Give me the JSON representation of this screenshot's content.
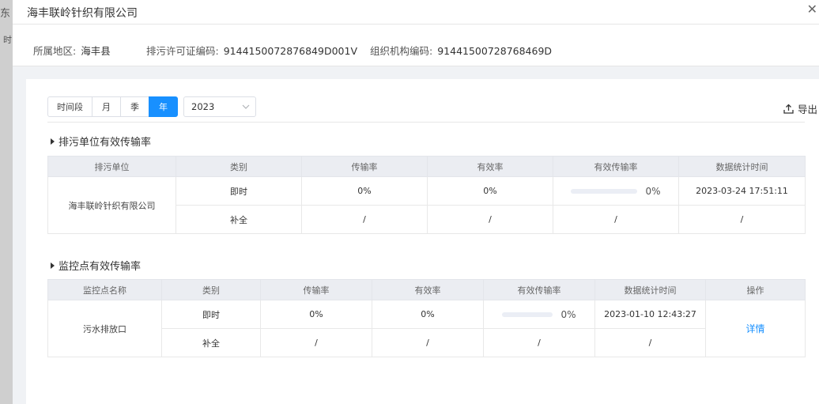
{
  "background": {
    "tab_fragment": "东",
    "sub_fragment": "时"
  },
  "dialog": {
    "title": "海丰联岭针织有限公司",
    "close_glyph": "✕"
  },
  "info": {
    "region_label": "所属地区:",
    "region_value": "海丰县",
    "permit_label": "排污许可证编码:",
    "permit_value": "9144150072876849D001V",
    "org_label": "组织机构编码:",
    "org_value": "91441500728768469D"
  },
  "toolbar": {
    "periods": [
      "时间段",
      "月",
      "季",
      "年"
    ],
    "active_period": "年",
    "year_value": "2023",
    "export_label": "导出"
  },
  "colors": {
    "accent": "#1890ff",
    "header_bg": "#ebedf2"
  },
  "unit_section": {
    "title": "排污单位有效传输率",
    "headers": [
      "排污单位",
      "类别",
      "传输率",
      "有效率",
      "有效传输率",
      "数据统计时间"
    ],
    "unit_name": "海丰联岭针织有限公司",
    "rows": [
      {
        "category": "即时",
        "transmit": "0%",
        "valid": "0%",
        "effective_pct": "0%",
        "effective_value": 0,
        "time": "2023-03-24 17:51:11"
      },
      {
        "category": "补全",
        "transmit": "/",
        "valid": "/",
        "effective_pct": "/",
        "time": "/"
      }
    ]
  },
  "monitor_section": {
    "title": "监控点有效传输率",
    "headers": [
      "监控点名称",
      "类别",
      "传输率",
      "有效率",
      "有效传输率",
      "数据统计时间",
      "操作"
    ],
    "point_name": "污水排放口",
    "action_label": "详情",
    "rows": [
      {
        "category": "即时",
        "transmit": "0%",
        "valid": "0%",
        "effective_pct": "0%",
        "effective_value": 0,
        "time": "2023-01-10 12:43:27"
      },
      {
        "category": "补全",
        "transmit": "/",
        "valid": "/",
        "effective_pct": "/",
        "time": "/"
      }
    ]
  }
}
